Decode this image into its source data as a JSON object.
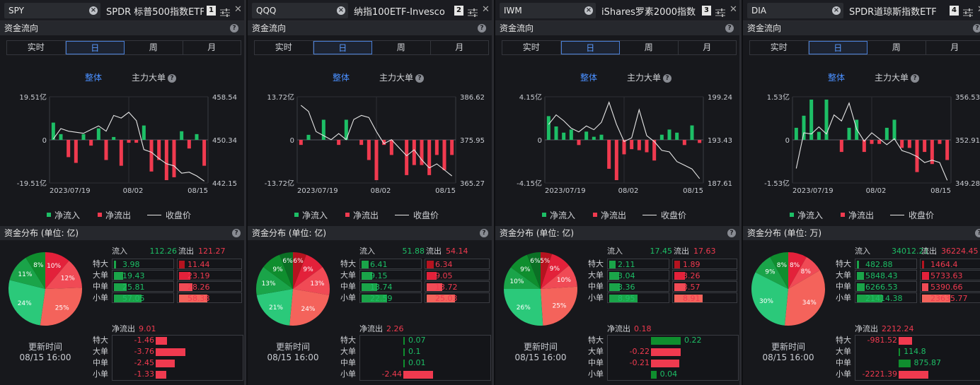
{
  "panels": [
    {
      "ticker": "SPY",
      "name": "SPDR 标普500指数ETF",
      "index": "1",
      "unit_title": "资金分布 (单位: 亿)",
      "y_left": [
        "19.51亿",
        "0",
        "-19.51亿"
      ],
      "y_right": [
        "458.54",
        "450.34",
        "442.15"
      ],
      "x_labels": [
        "2023/07/19",
        "08/02",
        "08/15"
      ],
      "flows": [
        6,
        2,
        -6,
        -8,
        2,
        -2,
        4,
        -7,
        1,
        -9,
        -1,
        -1,
        5,
        -11,
        -7,
        -14,
        -13,
        3,
        -3,
        2,
        -9
      ],
      "closes": [
        450.5,
        452.5,
        452,
        451.8,
        451.6,
        452.3,
        453,
        452,
        455,
        454.5,
        455.6,
        454,
        448.5,
        448,
        446.8,
        445.8,
        445.4,
        444,
        444.2,
        443.5,
        442.5
      ],
      "inflow": "112.26",
      "outflow": "121.27",
      "dist_in": [
        "3.98",
        "19.43",
        "25.81",
        "57.05"
      ],
      "dist_out": [
        "11.44",
        "23.19",
        "28.26",
        "58.38"
      ],
      "pie": [
        [
          10,
          "10%"
        ],
        [
          12,
          "12%"
        ],
        [
          25,
          "25%"
        ],
        [
          24,
          "24%"
        ],
        [
          11,
          "11%"
        ],
        [
          8,
          "8%"
        ]
      ],
      "net_label": "净流出",
      "net_value": "9.01",
      "net": [
        "-1.46",
        "-3.76",
        "-2.45",
        "-1.33"
      ],
      "netv": [
        -1.46,
        -3.76,
        -2.45,
        -1.33
      ],
      "netmax": 3.76
    },
    {
      "ticker": "QQQ",
      "name": "纳指100ETF-Invesco",
      "index": "2",
      "unit_title": "资金分布 (单位: 亿)",
      "y_left": [
        "13.72亿",
        "0",
        "-13.72亿"
      ],
      "y_right": [
        "386.62",
        "375.95",
        "365.27"
      ],
      "x_labels": [
        "2023/07/19",
        "08/02",
        "08/15"
      ],
      "flows": [
        -1,
        1,
        0,
        4,
        0,
        -1,
        4,
        0,
        -1,
        -4,
        -8,
        -1,
        -3,
        0,
        -7,
        -5,
        -5,
        -7,
        -3,
        -6,
        -3
      ],
      "closes": [
        384.5,
        383,
        378,
        377,
        376,
        377.5,
        376,
        381,
        382,
        381.5,
        378,
        375,
        376,
        374,
        372,
        373.5,
        371,
        369,
        370,
        368.5,
        367
      ],
      "inflow": "51.88",
      "outflow": "54.14",
      "dist_in": [
        "6.41",
        "9.15",
        "13.74",
        "22.59"
      ],
      "dist_out": [
        "6.34",
        "9.05",
        "13.72",
        "25.03"
      ],
      "pie": [
        [
          6,
          "6%"
        ],
        [
          9,
          "9%"
        ],
        [
          13,
          "13%"
        ],
        [
          24,
          "24%"
        ],
        [
          21,
          "21%"
        ],
        [
          13,
          "13%"
        ],
        [
          9,
          "9%"
        ],
        [
          6,
          "6%"
        ]
      ],
      "net_label": "净流出",
      "net_value": "2.26",
      "net": [
        "0.07",
        "0.1",
        "0.01",
        "-2.44"
      ],
      "netv": [
        0.07,
        0.1,
        0.01,
        -2.44
      ],
      "netmax": 2.44
    },
    {
      "ticker": "IWM",
      "name": "iShares罗素2000指数",
      "index": "3",
      "unit_title": "资金分布 (单位: 亿)",
      "y_left": [
        "4.15亿",
        "0",
        "-4.15亿"
      ],
      "y_right": [
        "199.24",
        "193.43",
        "187.61"
      ],
      "x_labels": [
        "2023/07/19",
        "08/02",
        "08/15"
      ],
      "flows": [
        2.3,
        1.3,
        0.7,
        1,
        -0.5,
        0.8,
        0.3,
        0.5,
        -2.8,
        -3.9,
        -1.4,
        -0.9,
        -1,
        -1.2,
        -2,
        0.5,
        1,
        0.7,
        -0.5,
        1.4,
        -0.3
      ],
      "closes": [
        195.5,
        196.8,
        196,
        195,
        194.5,
        195.3,
        194.8,
        195.8,
        198.5,
        195.5,
        193.2,
        193.7,
        197.5,
        194,
        193.2,
        192,
        191.8,
        190.5,
        190,
        189.5,
        188.2
      ],
      "inflow": "17.45",
      "outflow": "17.63",
      "dist_in": [
        "2.11",
        "3.04",
        "3.36",
        "8.95"
      ],
      "dist_out": [
        "1.89",
        "3.26",
        "3.57",
        "8.91"
      ],
      "pie": [
        [
          5,
          "5%"
        ],
        [
          9,
          "9%"
        ],
        [
          10,
          "10%"
        ],
        [
          25,
          "25%"
        ],
        [
          26,
          "26%"
        ],
        [
          10,
          "10%"
        ],
        [
          9,
          "9%"
        ],
        [
          6,
          "6%"
        ]
      ],
      "net_label": "净流出",
      "net_value": "0.18",
      "net": [
        "0.22",
        "-0.22",
        "-0.21",
        "0.04"
      ],
      "netv": [
        0.22,
        -0.22,
        -0.21,
        0.04
      ],
      "netmax": 0.22
    },
    {
      "ticker": "DIA",
      "name": "SPDR道琼斯指数ETF",
      "index": "4",
      "unit_title": "资金分布 (单位: 万)",
      "y_left": [
        "1.53亿",
        "0",
        "-1.53亿"
      ],
      "y_right": [
        "356.53",
        "352.91",
        "349.28"
      ],
      "x_labels": [
        "2023/07/19",
        "08/02",
        "08/15"
      ],
      "flows": [
        0.3,
        0.6,
        1,
        0.2,
        1,
        0,
        -0.3,
        0.3,
        0.5,
        -0.3,
        -0.1,
        -0.1,
        0.3,
        0.5,
        -0.2,
        -0.2,
        -0.8,
        -0.3,
        -0.6,
        -0.1,
        -0.5
      ],
      "closes": [
        350.5,
        353.5,
        353.4,
        354,
        353.4,
        355,
        354.5,
        356,
        353.8,
        352.8,
        353.5,
        353,
        352.5,
        353,
        352,
        351.8,
        351.5,
        351,
        351.2,
        351,
        349.5
      ],
      "inflow": "34012.21",
      "outflow": "36224.45",
      "dist_in": [
        "482.88",
        "5848.43",
        "6266.53",
        "21414.38"
      ],
      "dist_out": [
        "1464.4",
        "5733.63",
        "5390.66",
        "23635.77"
      ],
      "pie": [
        [
          8,
          "8%"
        ],
        [
          8,
          "8%"
        ],
        [
          34,
          "34%"
        ],
        [
          30,
          "30%"
        ],
        [
          9,
          "9%"
        ],
        [
          8,
          "8%"
        ]
      ],
      "net_label": "净流出",
      "net_value": "2212.24",
      "net": [
        "-981.52",
        "114.8",
        "875.87",
        "-2221.39"
      ],
      "netv": [
        -981.52,
        114.8,
        875.87,
        -2221.39
      ],
      "netmax": 2221.39
    }
  ],
  "labels": {
    "section_flow": "资金流向",
    "tabs": [
      "实时",
      "日",
      "周",
      "月"
    ],
    "sub_total": "整体",
    "sub_main": "主力大单",
    "legend_in": "净流入",
    "legend_out": "净流出",
    "legend_close": "收盘价",
    "row_labels": [
      "特大",
      "大单",
      "中单",
      "小单"
    ],
    "col_in": "流入",
    "col_out": "流出",
    "update_label": "更新时间",
    "update_time": "08/15 16:00",
    "help": "?"
  },
  "colors": {
    "green": "#1dbf66",
    "red": "#f03a4f",
    "line": "#e6e6e6",
    "pie_reds": [
      "#b5131f",
      "#e3213a",
      "#f04a55",
      "#f4635b"
    ],
    "pie_greens": [
      "#2bc97a",
      "#1aa449",
      "#0f8e2e",
      "#0b7025"
    ]
  }
}
